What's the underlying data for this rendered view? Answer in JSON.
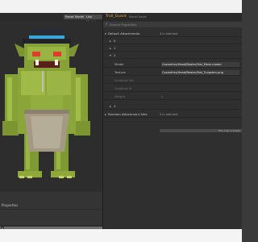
{
  "viewport": {
    "toolbar": {
      "reset_label": "Reset Model",
      "use_label": "Use Model"
    }
  },
  "bottom_panel": {
    "title": "Properties"
  },
  "properties": {
    "tab_title": "Troll_Guard",
    "tab_meta": "Model Asset",
    "search_placeholder": "Search Properties",
    "attachments": {
      "label": "Default Attachments",
      "value": "4 in element"
    },
    "items": [
      {
        "index": "0"
      },
      {
        "index": "1"
      },
      {
        "index": "2"
      }
    ],
    "fields": [
      {
        "label": "Model",
        "value": "Cosmetics/Head/Beater/Hat_Mesh.model"
      },
      {
        "label": "Texture",
        "value": "Cosmetics/Head/Beater/Hat_Tungsten.png"
      },
      {
        "label": "Gradient Set",
        "value": ""
      },
      {
        "label": "Gradient Id",
        "value": ""
      },
      {
        "label": "Weight",
        "value": "0"
      }
    ],
    "item3": {
      "index": "3"
    },
    "random_attachment": {
      "label": "Random Attachment Sets",
      "value": "0 in element"
    },
    "add_hint": "This map is empty"
  },
  "colors": {
    "accent": "#f0a43c",
    "panel": "#2f2f2f"
  }
}
